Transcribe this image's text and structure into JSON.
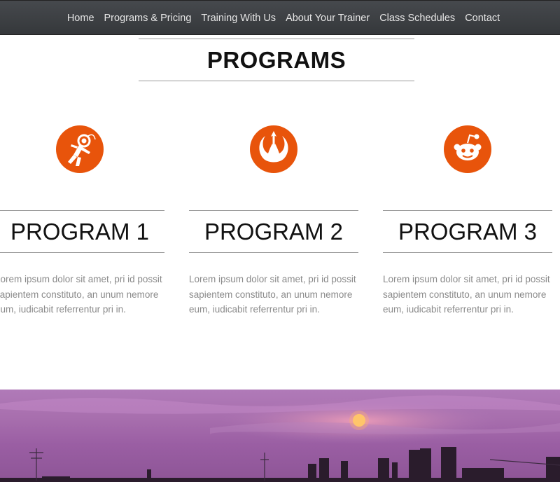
{
  "nav": {
    "items": [
      {
        "label": "Home"
      },
      {
        "label": "Programs & Pricing"
      },
      {
        "label": "Training With Us"
      },
      {
        "label": "About Your Trainer"
      },
      {
        "label": "Class Schedules"
      },
      {
        "label": "Contact"
      }
    ]
  },
  "programs_section": {
    "title": "PROGRAMS",
    "accent_color": "#e8540b",
    "items": [
      {
        "icon": "astronaut-icon",
        "title": "PROGRAM 1",
        "text": "Lorem ipsum dolor sit amet, pri id possit sapientem constituto, an unum nemore eum, iudicabit referrentur pri in."
      },
      {
        "icon": "rebel-alliance-icon",
        "title": "PROGRAM 2",
        "text": "Lorem ipsum dolor sit amet, pri id possit sapientem constituto, an unum nemore eum, iudicabit referrentur pri in."
      },
      {
        "icon": "reddit-alien-icon",
        "title": "PROGRAM 3",
        "text": "Lorem ipsum dolor sit amet, pri id possit sapientem constituto, an unum nemore eum, iudicabit referrentur pri in."
      }
    ]
  },
  "hero_banner": {
    "image": "purple-sunset-rooftops"
  }
}
